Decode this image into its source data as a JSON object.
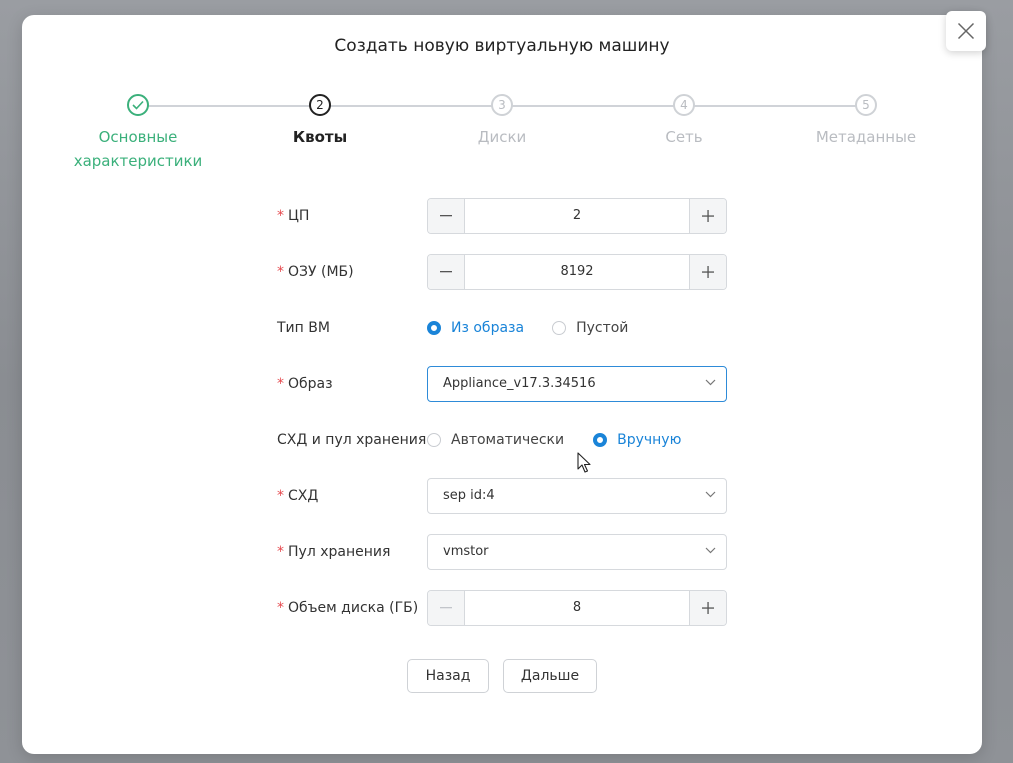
{
  "dialog": {
    "title": "Создать новую виртуальную машину",
    "close_icon": "close-icon"
  },
  "steps": [
    {
      "number": "✓",
      "label_line1": "Основные",
      "label_line2": "характеристики",
      "state": "done"
    },
    {
      "number": "2",
      "label_line1": "Квоты",
      "label_line2": "",
      "state": "active"
    },
    {
      "number": "3",
      "label_line1": "Диски",
      "label_line2": "",
      "state": "pending"
    },
    {
      "number": "4",
      "label_line1": "Сеть",
      "label_line2": "",
      "state": "pending"
    },
    {
      "number": "5",
      "label_line1": "Метаданные",
      "label_line2": "",
      "state": "pending"
    }
  ],
  "form": {
    "cpu": {
      "label": "ЦП",
      "value": "2",
      "required": "*"
    },
    "ram": {
      "label": "ОЗУ (МБ)",
      "value": "8192",
      "required": "*"
    },
    "vm_type": {
      "label": "Тип ВМ",
      "options": [
        "Из образа",
        "Пустой"
      ],
      "selected": "Из образа"
    },
    "image": {
      "label": "Образ",
      "value": "Appliance_v17.3.34516",
      "required": "*"
    },
    "storage_mode": {
      "label": "СХД и пул хранения",
      "options": [
        "Автоматически",
        "Вручную"
      ],
      "selected": "Вручную"
    },
    "storage": {
      "label": "СХД",
      "value": "sep id:4",
      "required": "*"
    },
    "pool": {
      "label": "Пул хранения",
      "value": "vmstor",
      "required": "*"
    },
    "disk": {
      "label": "Объем диска (ГБ)",
      "value": "8",
      "required": "*"
    }
  },
  "buttons": {
    "back": "Назад",
    "next": "Дальше"
  },
  "colors": {
    "accent": "#1a84d8",
    "success": "#3bb07b",
    "required": "#e5484d"
  }
}
